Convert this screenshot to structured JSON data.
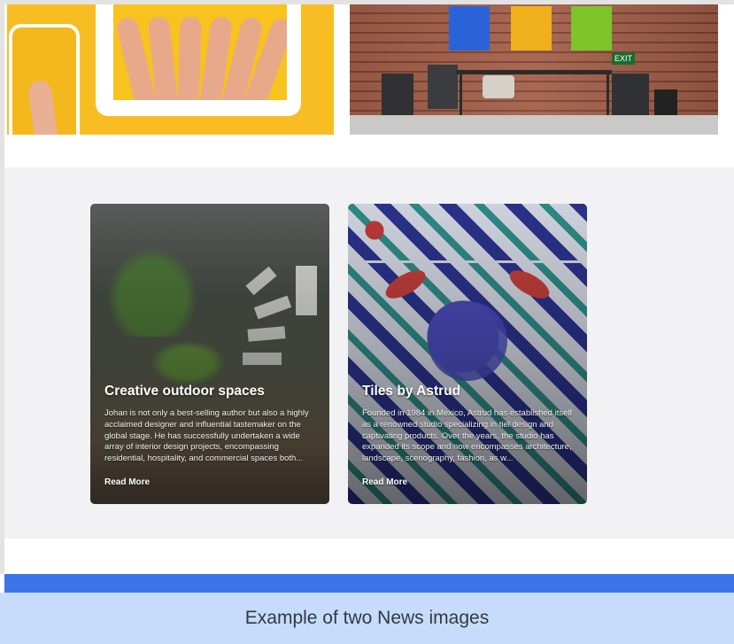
{
  "exit_sign": "EXIT",
  "news": {
    "cards": [
      {
        "title": "Creative outdoor spaces",
        "excerpt": "Johan is not only a best-selling author but also a highly acclaimed designer and influential tastemaker on the global stage. He has successfully undertaken a wide array of interior design projects, encompassing residential, hospitality, and commercial spaces both...",
        "link_label": "Read More"
      },
      {
        "title": "Tiles by Astrud",
        "excerpt": "Founded in 1984 in Mexico, Astrud has established itself as a renowned studio specializing in tiel design and captivating products. Over the years, the studio has expanded its scope and now encompasses architecture, landscape, scenography, fashion, as w...",
        "link_label": "Read More"
      }
    ]
  },
  "caption": "Example of two News images",
  "colors": {
    "accent_bar": "#3d74e8",
    "caption_bg": "#c7dcfb",
    "section_bg": "#f2f2f4"
  }
}
